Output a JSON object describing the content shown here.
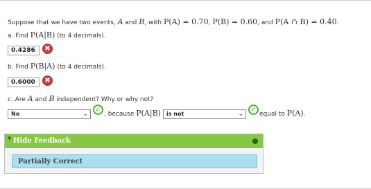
{
  "question": {
    "stem": {
      "t1": "Suppose that we have two events, ",
      "eventA": "A",
      "t2": " and ",
      "eventB": "B",
      "t3": ", with ",
      "pA": "P(A) = 0.70",
      "t4": ", ",
      "pB": "P(B) = 0.60",
      "t5": ", and ",
      "pAB": "P(A ∩ B) = 0.40",
      "t6": "."
    },
    "part_a": {
      "prefix": "a.",
      "t1": " Find ",
      "expr": "P(A|B)",
      "t2": " (to 4 decimals).",
      "answer": "0.4286",
      "mark": "✖"
    },
    "part_b": {
      "prefix": "b.",
      "t1": " Find ",
      "expr": "P(B|A)",
      "t2": " (to 4 decimals).",
      "answer": "0.6000",
      "mark": "✖"
    },
    "part_c": {
      "prefix": "c.",
      "t1": " Are ",
      "eventA": "A",
      "t2": " and ",
      "eventB": "B",
      "t3": " independent? Why or why not?",
      "select1_value": "No",
      "select1_chevron": "⌄",
      "check_mark": "✓",
      "because_text": ", because ",
      "because_expr": "P(A|B)",
      "select2_value": "is not",
      "select2_chevron": "⌄",
      "equal_text": " equal to ",
      "equal_expr": "P(A)",
      "end": "."
    }
  },
  "feedback": {
    "header_label": "Hide Feedback",
    "status": "Partially Correct",
    "header_color": "#86c843",
    "status_bg": "#a9dfef"
  },
  "colors": {
    "incorrect": "#d83a3a",
    "correct": "#47b52a"
  }
}
